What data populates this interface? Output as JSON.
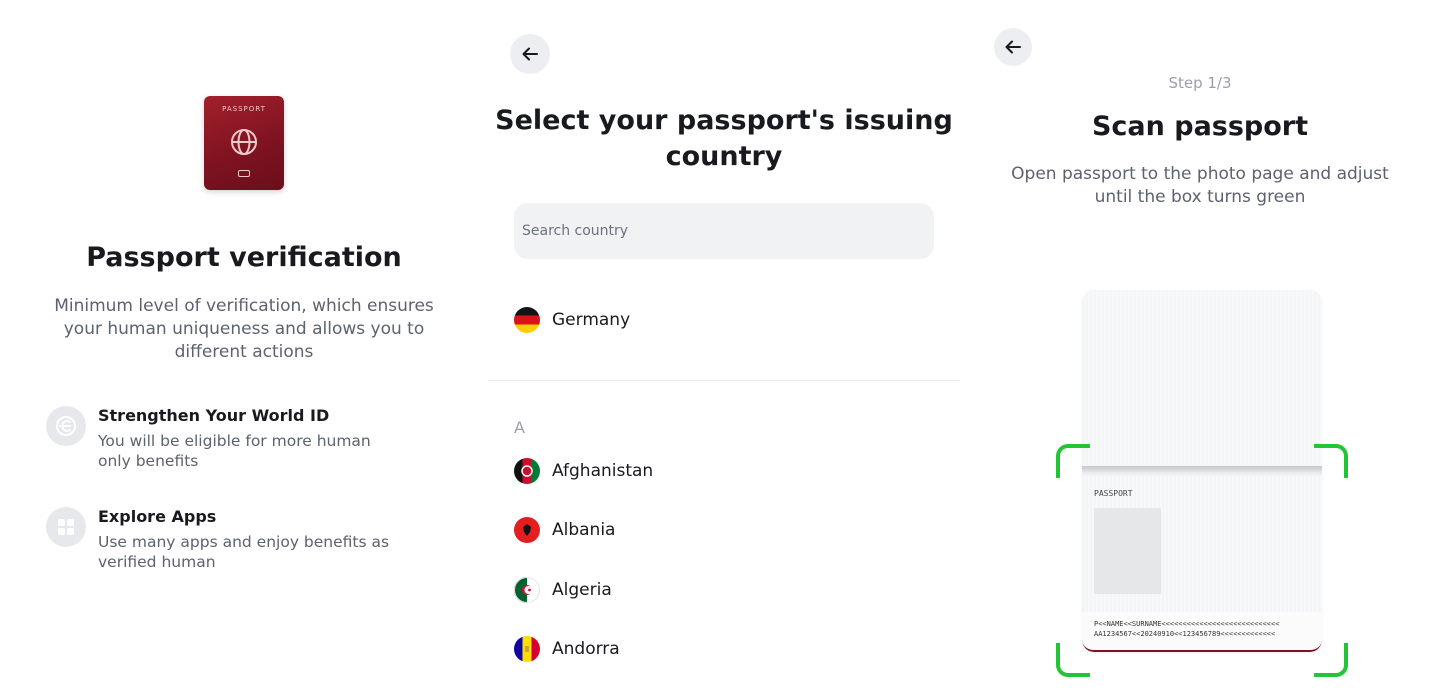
{
  "intro": {
    "passport_cover_label": "PASSPORT",
    "title": "Passport verification",
    "description": "Minimum level of verification, which ensures your human uniqueness and allows you to different actions",
    "features": [
      {
        "icon": "world-id-icon",
        "title": "Strengthen Your World ID",
        "subtitle": "You will be eligible for more human only benefits"
      },
      {
        "icon": "apps-grid-icon",
        "title": "Explore Apps",
        "subtitle": "Use many apps and enjoy benefits as verified human"
      }
    ]
  },
  "country_select": {
    "back_icon": "arrow-left-icon",
    "title": "Select your passport's issuing country",
    "search": {
      "placeholder": "Search country",
      "value": ""
    },
    "suggested": [
      {
        "name": "Germany",
        "flag": "flag-germany"
      }
    ],
    "section_letter": "A",
    "countries": [
      {
        "name": "Afghanistan",
        "flag": "flag-afghanistan"
      },
      {
        "name": "Albania",
        "flag": "flag-albania"
      },
      {
        "name": "Algeria",
        "flag": "flag-algeria"
      },
      {
        "name": "Andorra",
        "flag": "flag-andorra"
      }
    ]
  },
  "scan": {
    "back_icon": "arrow-left-icon",
    "step": "Step 1/3",
    "title": "Scan passport",
    "description": "Open passport to the photo page and adjust until the box turns green",
    "page_label": "PASSPORT",
    "mrz_line_1": "P<<NAME<<SURNAME<<<<<<<<<<<<<<<<<<<<<<<<<<<<",
    "mrz_line_2": "AA1234567<<20240910<<123456789<<<<<<<<<<<<<",
    "frame_color": "#22c533"
  },
  "colors": {
    "passport_red": "#7d1220",
    "scan_frame": "#22c533",
    "muted_text": "#5c6270"
  }
}
